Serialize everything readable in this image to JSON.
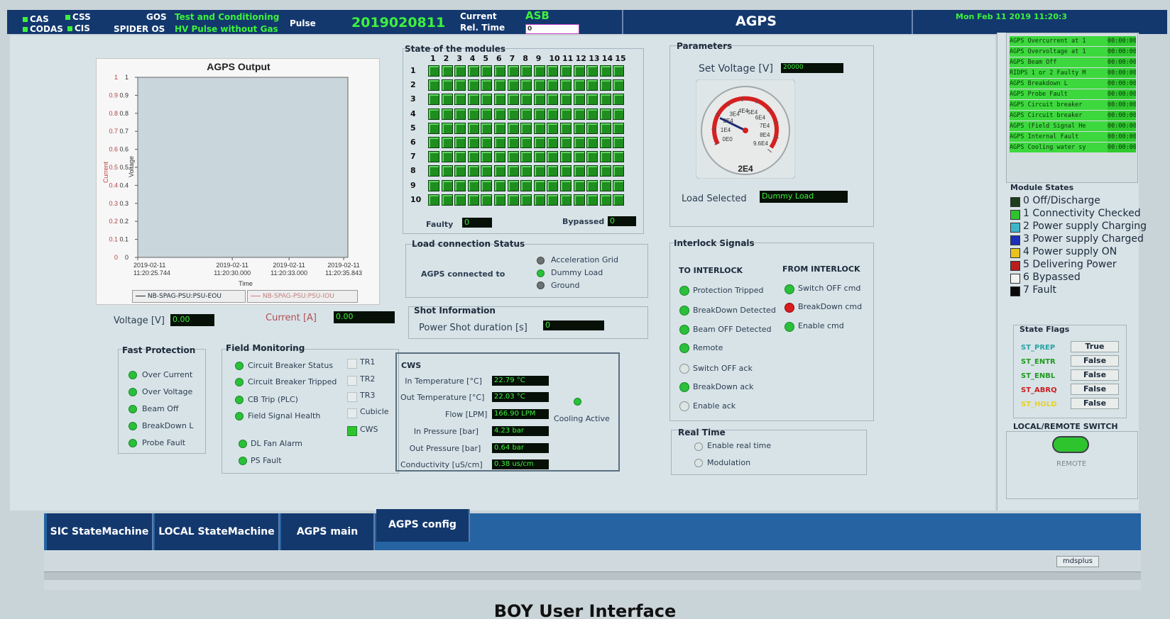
{
  "header": {
    "cas": "CAS",
    "css": "CSS",
    "codas": "CODAS",
    "cis": "CIS",
    "gos_label": "GOS",
    "gos_value": "Test and Conditioning",
    "spider_label": "SPIDER OS",
    "spider_value": "HV Pulse without Gas",
    "pulse_label": "Pulse",
    "pulse_value": "2019020811",
    "current_label": "Current",
    "current_value": "ASB",
    "rel_time_label": "Rel. Time",
    "rel_time_value": "0",
    "title": "AGPS",
    "datetime": "Mon Feb 11 2019 11:20:3"
  },
  "chart_data": {
    "type": "line",
    "title": "AGPS Output",
    "xlabel": "Time",
    "ylabel_left": "Current",
    "ylabel_right": "Voltage",
    "y_ticks": [
      "0",
      "0.1",
      "0.2",
      "0.3",
      "0.4",
      "0.5",
      "0.6",
      "0.7",
      "0.8",
      "0.9",
      "1"
    ],
    "x_ticks": [
      {
        "date": "2019-02-11",
        "time": "11:20:25.744"
      },
      {
        "date": "2019-02-11",
        "time": "11:20:30.000"
      },
      {
        "date": "2019-02-11",
        "time": "11:20:33.000"
      },
      {
        "date": "2019-02-11",
        "time": "11:20:35.843"
      }
    ],
    "ylim": [
      0,
      1
    ],
    "series": [
      {
        "name": "NB-SPAG-PSU:PSU-EOU",
        "values": [],
        "color": "#222222"
      },
      {
        "name": "NB-SPAG-PSU:PSU-IOU",
        "values": [],
        "color": "#d08080"
      }
    ]
  },
  "output": {
    "voltage_label": "Voltage [V]",
    "voltage_value": "0.00",
    "current_label": "Current [A]",
    "current_value": "0.00"
  },
  "modules": {
    "title": "State of the modules",
    "columns": [
      "1",
      "2",
      "3",
      "4",
      "5",
      "6",
      "7",
      "8",
      "9",
      "10",
      "11",
      "12",
      "13",
      "14",
      "15"
    ],
    "rows": [
      "1",
      "2",
      "3",
      "4",
      "5",
      "6",
      "7",
      "8",
      "9",
      "10"
    ],
    "faulty_label": "Faulty",
    "faulty_value": "0",
    "bypassed_label": "Bypassed",
    "bypassed_value": "0"
  },
  "parameters": {
    "title": "Parameters",
    "set_voltage_label": "Set Voltage [V]",
    "set_voltage_value": "20000",
    "gauge_ticks": [
      "0E0",
      "1E4",
      "2E4",
      "3E4",
      "4E4",
      "5E4",
      "6E4",
      "7E4",
      "8E4",
      "9.6E4"
    ],
    "gauge_value_label": "2E4",
    "gauge_value": 20000,
    "gauge_max": 96000,
    "load_selected_label": "Load Selected",
    "load_selected_value": "Dummy Load"
  },
  "load_connection": {
    "title": "Load connection Status",
    "connected_label": "AGPS connected to",
    "options": [
      {
        "label": "Acceleration Grid",
        "state": "grey"
      },
      {
        "label": "Dummy Load",
        "state": "green"
      },
      {
        "label": "Ground",
        "state": "grey"
      }
    ]
  },
  "shot": {
    "title": "Shot Information",
    "duration_label": "Power Shot duration [s]",
    "duration_value": "0"
  },
  "interlock": {
    "title": "Interlock Signals",
    "to_title": "TO INTERLOCK",
    "from_title": "FROM INTERLOCK",
    "to_items": [
      {
        "label": "Protection Tripped",
        "state": "green"
      },
      {
        "label": "BreakDown Detected",
        "state": "green"
      },
      {
        "label": "Beam OFF Detected",
        "state": "green"
      },
      {
        "label": "Remote",
        "state": "green"
      },
      {
        "label": "Switch OFF ack",
        "state": "off"
      },
      {
        "label": "BreakDown ack",
        "state": "green"
      },
      {
        "label": "Enable ack",
        "state": "off"
      }
    ],
    "from_items": [
      {
        "label": "Switch OFF cmd",
        "state": "green"
      },
      {
        "label": "BreakDown cmd",
        "state": "red"
      },
      {
        "label": "Enable cmd",
        "state": "green"
      }
    ]
  },
  "real_time": {
    "title": "Real Time",
    "enable_label": "Enable real time",
    "modulation_label": "Modulation"
  },
  "fast_protection": {
    "title": "Fast Protection",
    "items": [
      "Over Current",
      "Over Voltage",
      "Beam Off",
      "BreakDown L",
      "Probe Fault"
    ]
  },
  "field_monitoring": {
    "title": "Field Monitoring",
    "items": [
      "Circuit Breaker Status",
      "Circuit Breaker Tripped",
      "CB Trip (PLC)",
      "Field Signal Health"
    ],
    "items2": [
      "DL Fan Alarm",
      "PS Fault"
    ],
    "boxes": [
      "TR1",
      "TR2",
      "TR3",
      "Cubicle",
      "CWS"
    ]
  },
  "cws": {
    "title": "CWS",
    "rows": [
      {
        "label": "In Temperature [°C]",
        "value": "22.79 °C"
      },
      {
        "label": "Out Temperature [°C]",
        "value": "22.03 °C"
      },
      {
        "label": "Flow [LPM]",
        "value": "166.90 LPM"
      },
      {
        "label": "In Pressure [bar]",
        "value": "4.23 bar"
      },
      {
        "label": "Out Pressure [bar]",
        "value": "0.64 bar"
      },
      {
        "label": "Conductivity [uS/cm]",
        "value": "0.38 us/cm"
      }
    ],
    "cooling_label": "Cooling Active"
  },
  "alarms": [
    {
      "text": "AGPS Overcurrent at 1",
      "time": "00:00:00"
    },
    {
      "text": "AGPS Overvoltage at 1",
      "time": "00:00:00"
    },
    {
      "text": "AGPS Beam Off",
      "time": "00:00:00"
    },
    {
      "text": "RIDPS 1 or 2 Faulty M",
      "time": "00:00:00"
    },
    {
      "text": "AGPS Breakdown L",
      "time": "00:00:00"
    },
    {
      "text": "AGPS Probe Fault",
      "time": "00:00:00"
    },
    {
      "text": "AGPS Circuit breaker",
      "time": "00:00:00"
    },
    {
      "text": "AGPS Circuit breaker",
      "time": "00:00:00"
    },
    {
      "text": "AGPS (Field Signal He",
      "time": "00:00:00"
    },
    {
      "text": "AGPS Internal Fault",
      "time": "00:00:00"
    },
    {
      "text": "AGPS Cooling water sy",
      "time": "00:00:00"
    }
  ],
  "module_states": {
    "title": "Module States",
    "items": [
      {
        "label": "0 Off/Discharge",
        "color": "#1d3d1d"
      },
      {
        "label": "1 Connectivity Checked",
        "color": "#2ec42e"
      },
      {
        "label": "2 Power supply Charging",
        "color": "#3fb6c8"
      },
      {
        "label": "3 Power supply Charged",
        "color": "#1b2fb8"
      },
      {
        "label": "4 Power supply ON",
        "color": "#e8c21e"
      },
      {
        "label": "5 Delivering Power",
        "color": "#b81e1e"
      },
      {
        "label": "6 Bypassed",
        "color": "#f2f2f2"
      },
      {
        "label": "7 Fault",
        "color": "#080808"
      }
    ]
  },
  "state_flags": {
    "title": "State Flags",
    "items": [
      {
        "name": "ST_PREP",
        "value": "True",
        "color": "#2aa3a3"
      },
      {
        "name": "ST_ENTR",
        "value": "False",
        "color": "#1e9a1e"
      },
      {
        "name": "ST_ENBL",
        "value": "False",
        "color": "#1e9a1e"
      },
      {
        "name": "ST_ABRQ",
        "value": "False",
        "color": "#c81e1e"
      },
      {
        "name": "ST_HOLD",
        "value": "False",
        "color": "#e8d21e"
      }
    ]
  },
  "switch": {
    "title": "LOCAL/REMOTE SWITCH",
    "state_label": "REMOTE"
  },
  "tabs": [
    "SIC StateMachine",
    "LOCAL StateMachine",
    "AGPS main",
    "AGPS config"
  ],
  "statusbar_text": "mdsplus",
  "footer_title": "BOY User Interface"
}
